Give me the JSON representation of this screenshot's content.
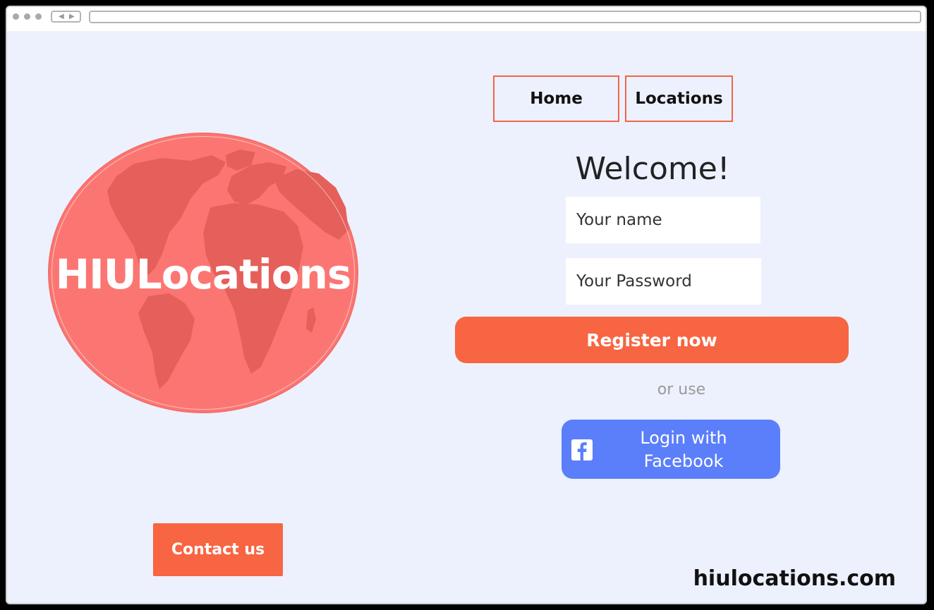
{
  "nav": {
    "home_label": "Home",
    "locations_label": "Locations"
  },
  "logo": {
    "text": "HIULocations",
    "globe_color": "#fb7672"
  },
  "form": {
    "welcome": "Welcome!",
    "name_placeholder": "Your name",
    "password_placeholder": "Your Password",
    "register_label": "Register now",
    "or_use": "or use",
    "facebook_label": "Login with Facebook"
  },
  "footer": {
    "contact_label": "Contact us",
    "domain": "hiulocations.com"
  },
  "colors": {
    "accent": "#f76542",
    "facebook": "#5b7ffb",
    "background": "#edf1fd"
  },
  "icons": {
    "facebook": "facebook-icon",
    "globe": "globe-icon"
  }
}
